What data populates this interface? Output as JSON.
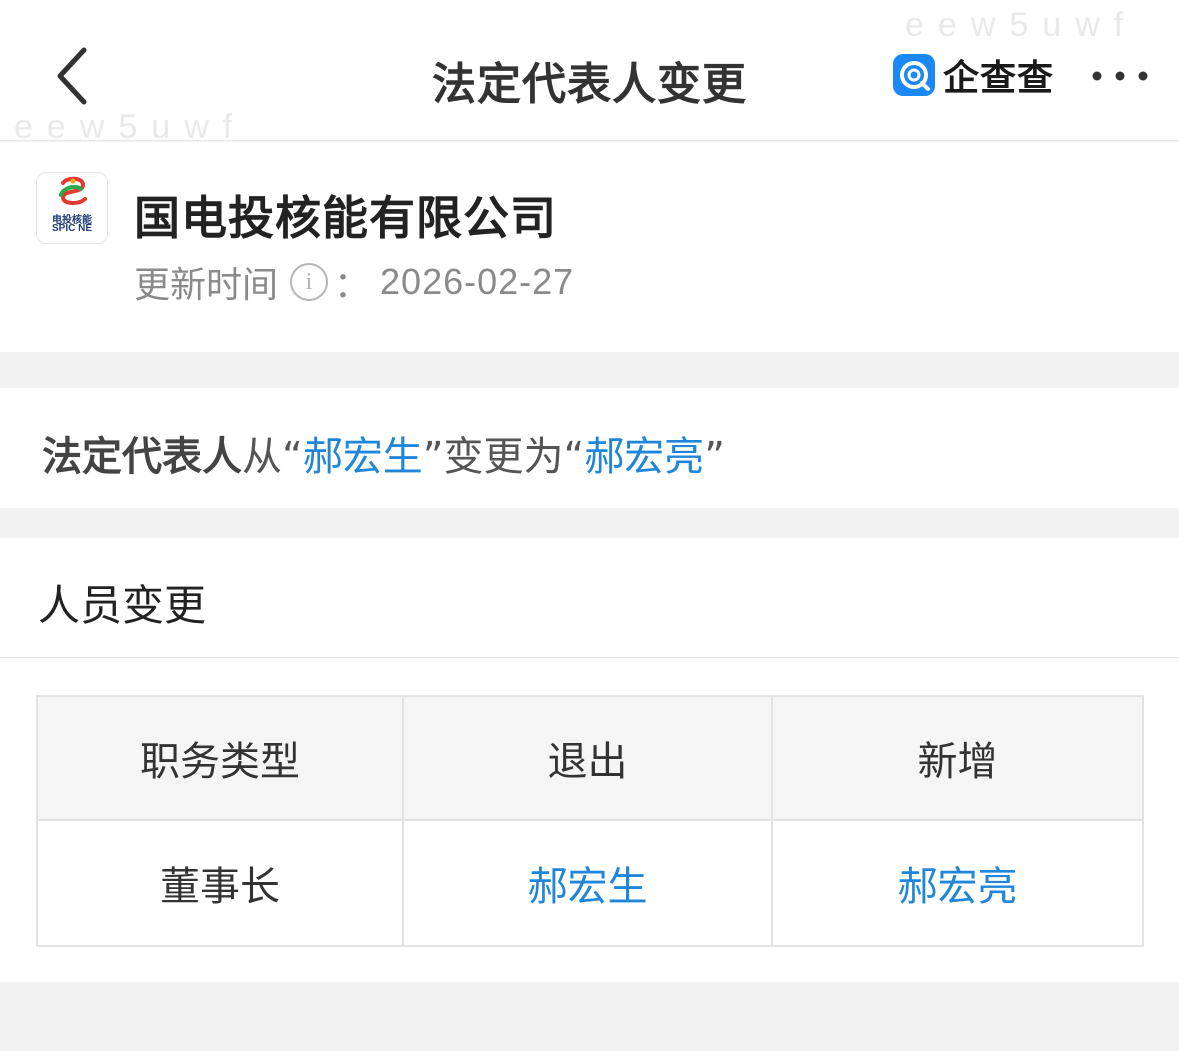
{
  "header": {
    "title": "法定代表人变更",
    "brand_name": "企查查",
    "back_icon": "chevron-left-icon",
    "more_icon": "more-dots-icon",
    "watermark": "eew5uwf"
  },
  "company": {
    "name": "国电投核能有限公司",
    "logo_text_cn": "电投核能",
    "logo_text_en": "SPIC NE",
    "update_label": "更新时间",
    "update_separator": "：",
    "update_date": "2026-02-27"
  },
  "summary": {
    "label": "法定代表人",
    "from_text": "从“",
    "old_person": "郝宏生",
    "mid_text": "”变更为“",
    "new_person": "郝宏亮",
    "end_text": "”"
  },
  "personnel": {
    "title": "人员变更",
    "columns": [
      "职务类型",
      "退出",
      "新增"
    ],
    "rows": [
      {
        "position": "董事长",
        "exit": "郝宏生",
        "added": "郝宏亮"
      }
    ]
  },
  "colors": {
    "link": "#1f86d9",
    "brand": "#1a89f5",
    "background": "#f2f2f2"
  }
}
